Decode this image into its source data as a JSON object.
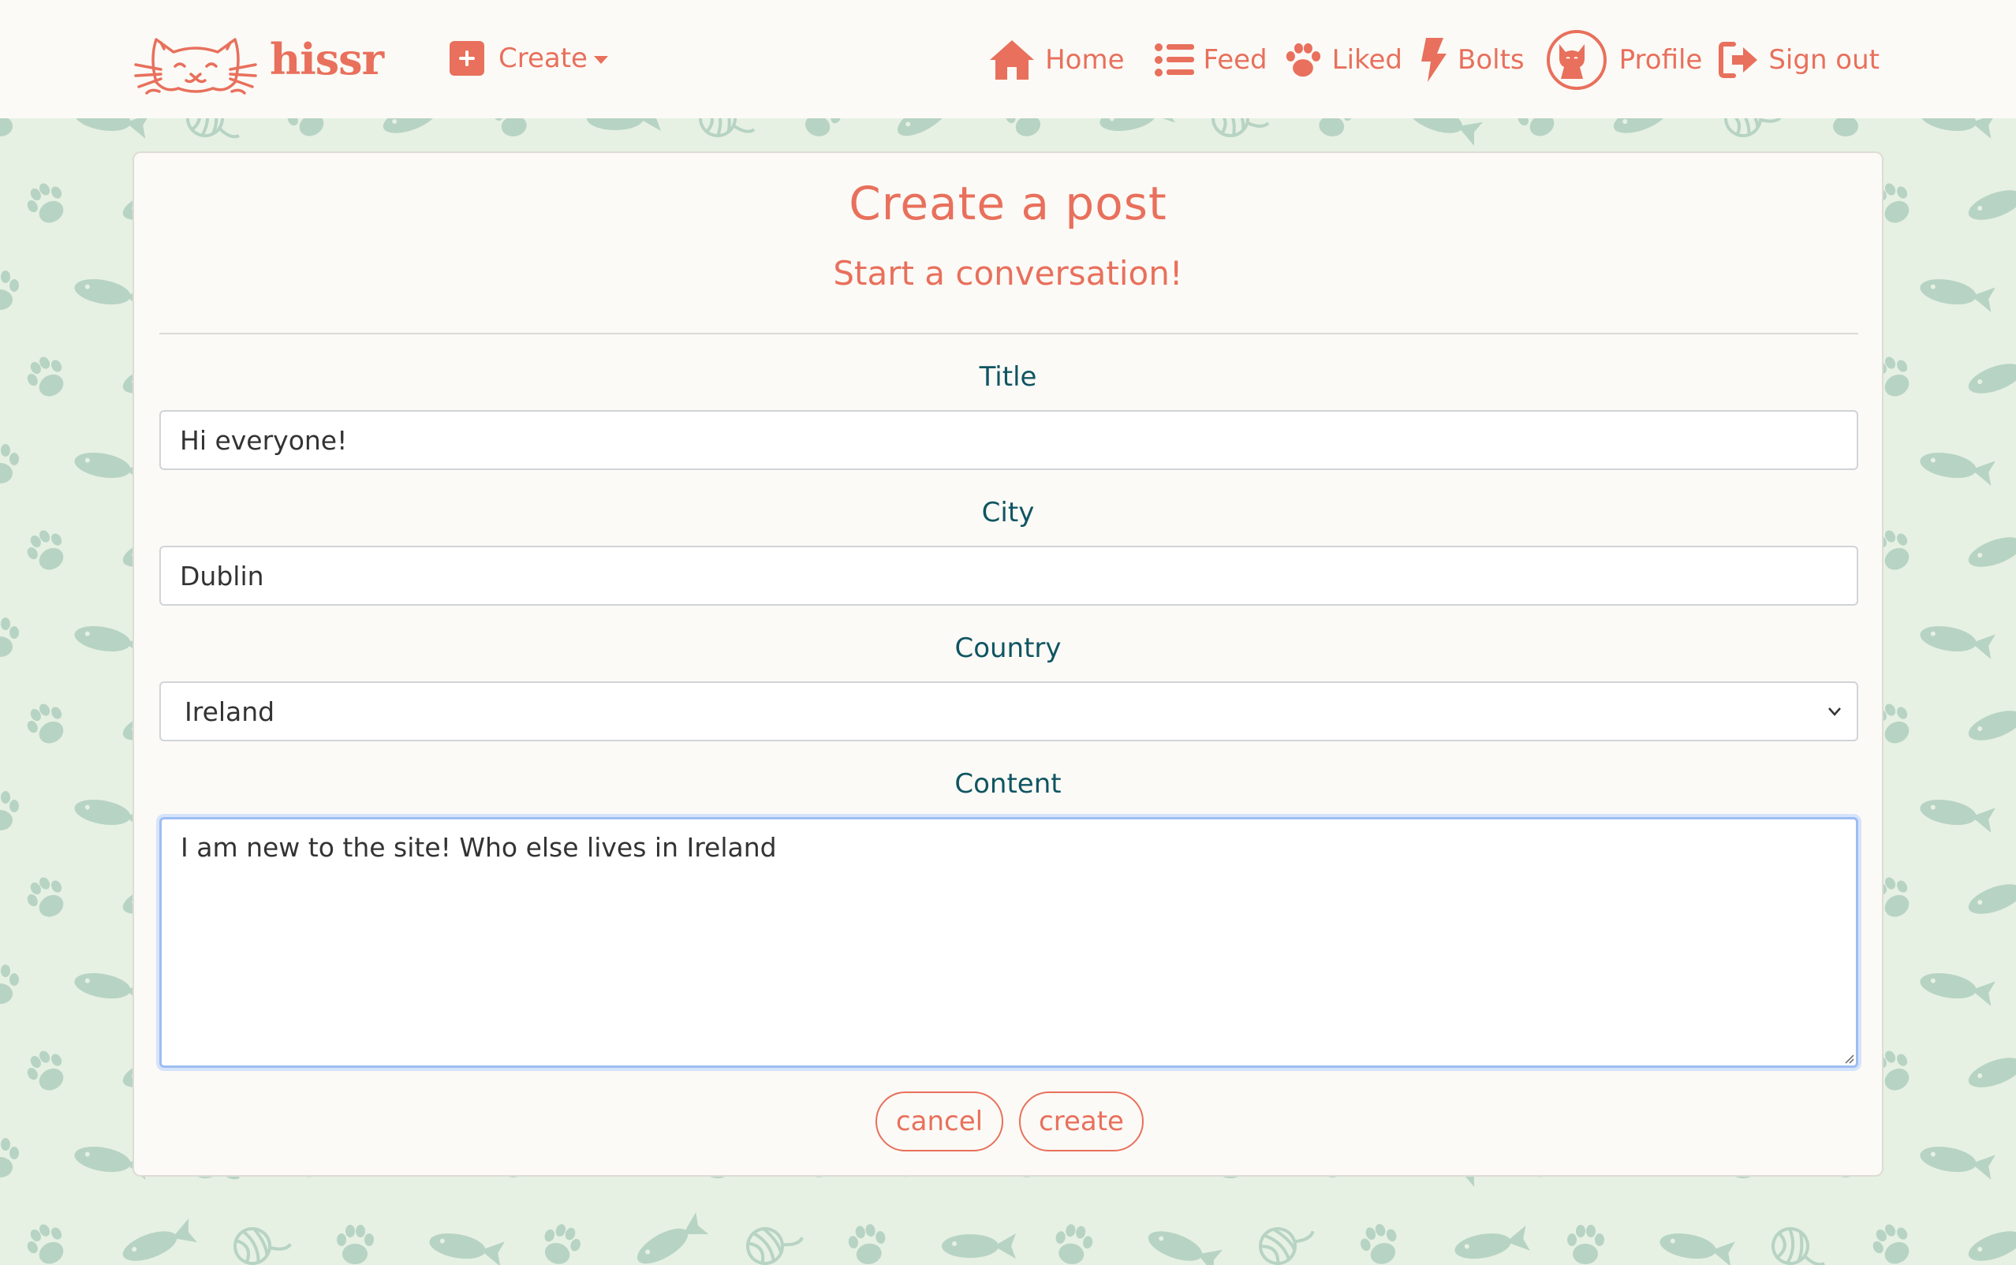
{
  "brand": {
    "name": "hissr",
    "logo_icon": "cat-face-logo"
  },
  "navbar": {
    "create_label": "Create",
    "create_icon": "plus-square-icon",
    "links": [
      {
        "label": "Home",
        "icon": "home-icon"
      },
      {
        "label": "Feed",
        "icon": "list-icon"
      },
      {
        "label": "Liked",
        "icon": "paw-icon"
      },
      {
        "label": "Bolts",
        "icon": "bolt-icon"
      },
      {
        "label": "Profile",
        "icon": "cat-avatar"
      },
      {
        "label": "Sign out",
        "icon": "sign-out-icon"
      }
    ]
  },
  "form": {
    "title": "Create a post",
    "subtitle": "Start a conversation!",
    "fields": {
      "title": {
        "label": "Title",
        "value": "Hi everyone!"
      },
      "city": {
        "label": "City",
        "value": "Dublin"
      },
      "country": {
        "label": "Country",
        "value": "Ireland"
      },
      "content": {
        "label": "Content",
        "value": "I am new to the site! Who else lives in Ireland"
      }
    },
    "buttons": {
      "cancel": "cancel",
      "create": "create"
    }
  },
  "colors": {
    "accent": "#e8705c",
    "label": "#0f5562",
    "background": "#e6f1e3",
    "pattern": "#b5d2c3",
    "card": "#fcfaf6",
    "focus_border": "#9dbdf2"
  }
}
